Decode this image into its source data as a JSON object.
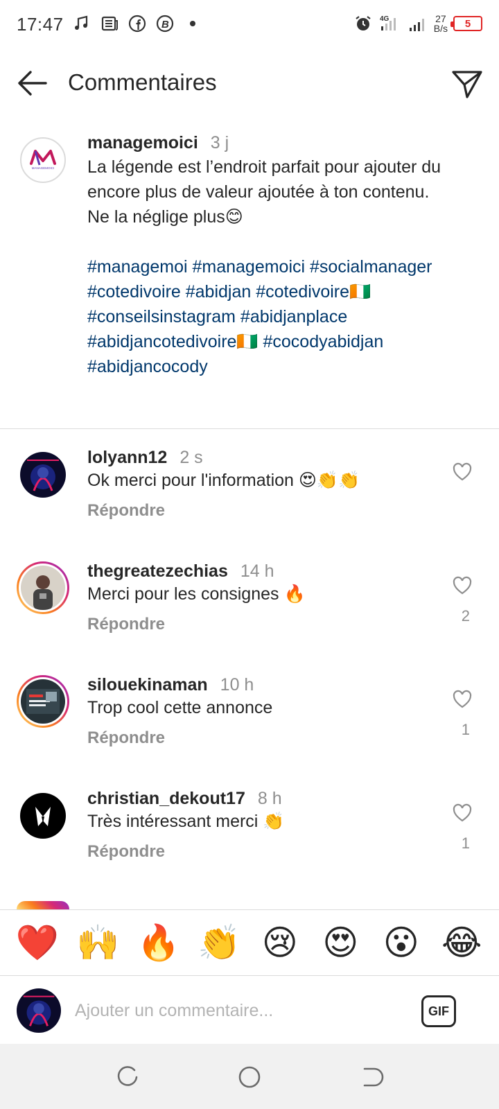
{
  "status_bar": {
    "time": "17:47",
    "network": "4G",
    "speed_value": "27",
    "speed_unit": "B/s",
    "battery": "5",
    "icons": [
      "music-icon",
      "news-icon",
      "facebook-icon",
      "bitcoin-icon",
      "dot-icon",
      "alarm-icon",
      "signal-icon"
    ]
  },
  "header": {
    "title": "Commentaires",
    "back_icon": "arrow-left-icon",
    "send_icon": "send-icon"
  },
  "caption": {
    "username": "managemoici",
    "time": "3 j",
    "text": "La légende est l’endroit parfait pour ajouter du encore plus de valeur ajoutée à ton contenu.\nNe la néglige plus😊",
    "hashtags": "#managemoi #managemoici #socialmanager #cotedivoire #abidjan #cotedivoire🇨🇮 #conseilsinstagram #abidjanplace #abidjancotedivoire🇨🇮 #cocodyabidjan #abidjancocody",
    "avatar_logo_text": "MANAGEMOICI"
  },
  "comments": [
    {
      "username": "lolyann12",
      "time": "2 s",
      "text": "Ok merci pour l'information 😍👏👏",
      "reply": "Répondre",
      "likes": ""
    },
    {
      "username": "thegreatezechias",
      "time": "14 h",
      "text": "Merci pour les consignes 🔥",
      "reply": "Répondre",
      "likes": "2"
    },
    {
      "username": "silouekinaman",
      "time": "10 h",
      "text": "Trop cool cette annonce",
      "reply": "Répondre",
      "likes": "1"
    },
    {
      "username": "christian_dekout17",
      "time": "8 h",
      "text": "Très intéressant merci 👏",
      "reply": "Répondre",
      "likes": "1"
    }
  ],
  "reactions": [
    "❤️",
    "🙌",
    "🔥",
    "👏",
    "😢",
    "😍",
    "😮",
    "😂"
  ],
  "input": {
    "placeholder": "Ajouter un commentaire...",
    "gif_label": "GIF"
  },
  "colors": {
    "hashtag": "#00376b",
    "muted": "#8e8e8e",
    "text": "#262626",
    "battery_low": "#e02424"
  }
}
